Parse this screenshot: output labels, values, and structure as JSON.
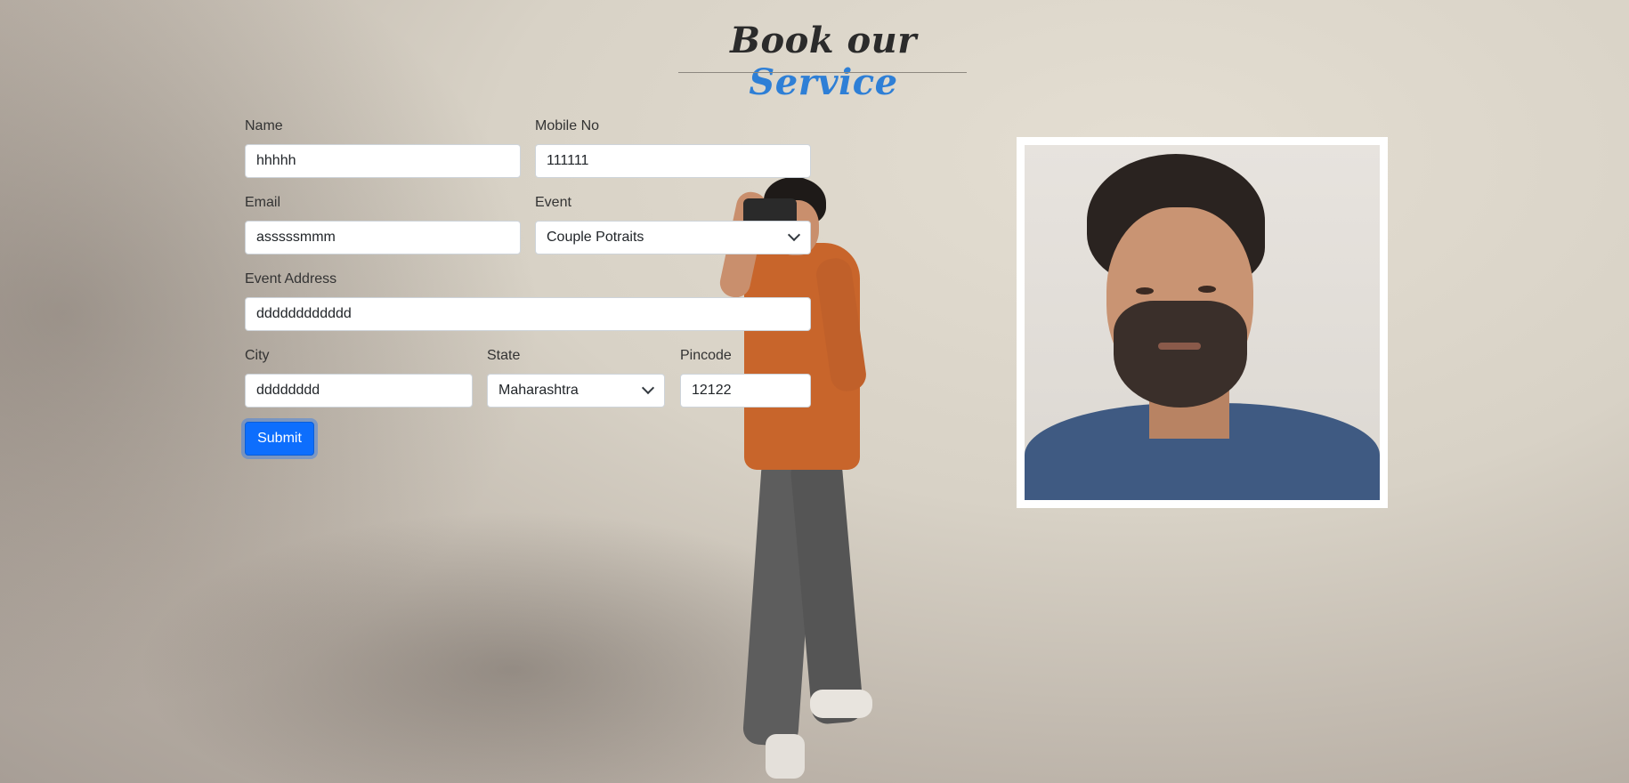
{
  "heading": {
    "part1": "Book our",
    "accent": "Service"
  },
  "form": {
    "name": {
      "label": "Name",
      "value": "hhhhh"
    },
    "mobile": {
      "label": "Mobile No",
      "value": "111111"
    },
    "email": {
      "label": "Email",
      "value": "asssssmmm"
    },
    "event": {
      "label": "Event",
      "value": "Couple Potraits"
    },
    "address": {
      "label": "Event Address",
      "value": "dddddddddddd"
    },
    "city": {
      "label": "City",
      "value": "dddddddd"
    },
    "state": {
      "label": "State",
      "value": "Maharashtra"
    },
    "pincode": {
      "label": "Pincode",
      "value": "12122"
    },
    "submit_label": "Submit"
  },
  "colors": {
    "accent": "#2e7fd6",
    "button": "#0d6efd"
  },
  "images": {
    "background": "photographer-with-camera",
    "portrait": "bearded-man-portrait"
  }
}
